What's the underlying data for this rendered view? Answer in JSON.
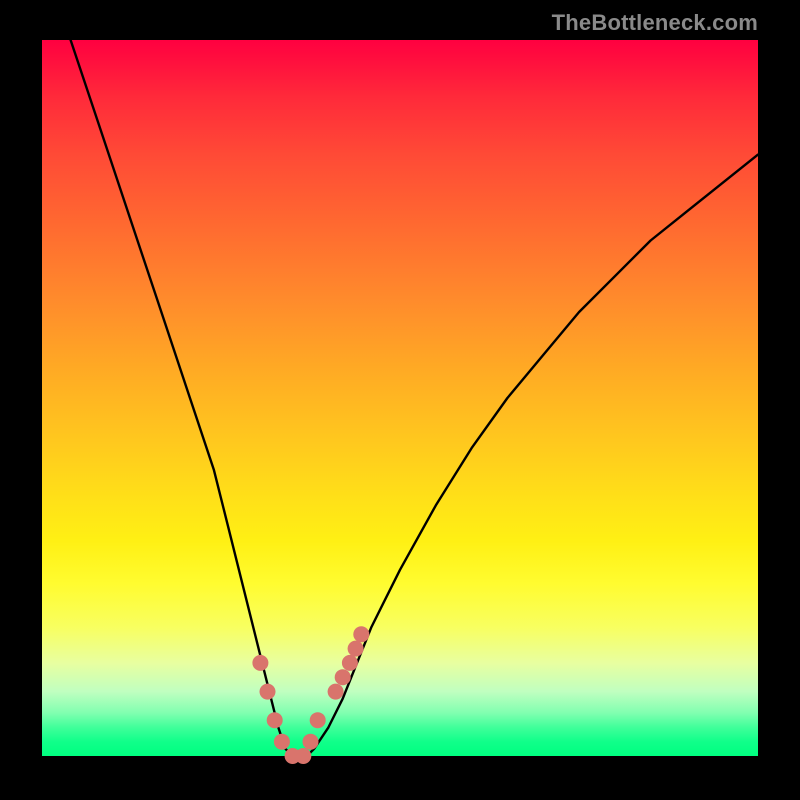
{
  "watermark": "TheBottleneck.com",
  "chart_data": {
    "type": "line",
    "title": "",
    "xlabel": "",
    "ylabel": "",
    "xlim": [
      0,
      100
    ],
    "ylim": [
      0,
      100
    ],
    "grid": false,
    "legend": false,
    "series": [
      {
        "name": "bottleneck-curve",
        "color": "#000000",
        "x": [
          4,
          8,
          12,
          16,
          20,
          24,
          26,
          28,
          30,
          32,
          33,
          34,
          35,
          36,
          37,
          38,
          40,
          42,
          44,
          46,
          50,
          55,
          60,
          65,
          70,
          75,
          80,
          85,
          90,
          95,
          100
        ],
        "y": [
          100,
          88,
          76,
          64,
          52,
          40,
          32,
          24,
          16,
          8,
          4,
          1,
          0,
          0,
          0,
          1,
          4,
          8,
          13,
          18,
          26,
          35,
          43,
          50,
          56,
          62,
          67,
          72,
          76,
          80,
          84
        ]
      },
      {
        "name": "highlight-dots",
        "color": "#d9746c",
        "x": [
          30.5,
          31.5,
          32.5,
          33.5,
          35.0,
          36.5,
          37.5,
          38.5,
          41.0,
          42.0,
          43.0,
          43.8,
          44.6
        ],
        "y": [
          13,
          9,
          5,
          2,
          0,
          0,
          2,
          5,
          9,
          11,
          13,
          15,
          17
        ]
      }
    ],
    "background_gradient": {
      "top": "#ff0040",
      "mid": "#ffe018",
      "bottom": "#00ff80"
    }
  }
}
